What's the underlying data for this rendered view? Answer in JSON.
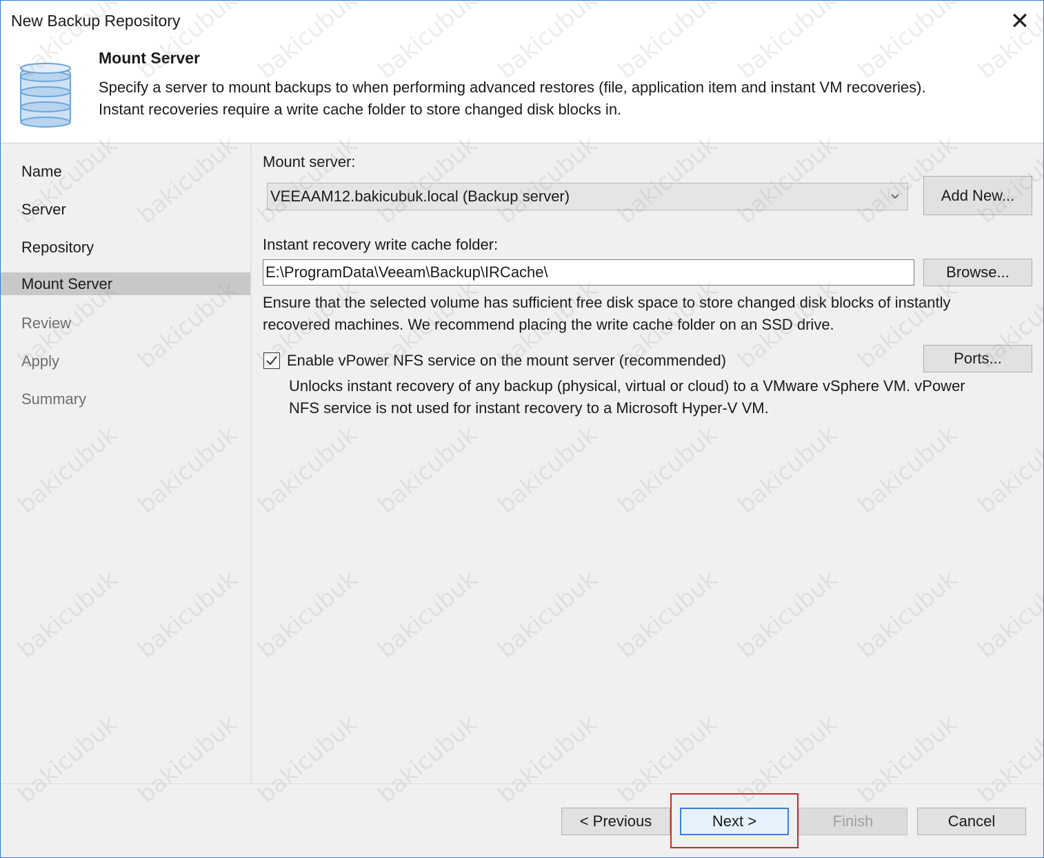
{
  "window": {
    "title": "New Backup Repository",
    "close_glyph": "✕"
  },
  "step": {
    "heading": "Mount Server",
    "description_line1": "Specify a server to mount backups to when performing advanced restores (file, application item and instant VM recoveries).",
    "description_line2": "Instant recoveries require a write cache folder to store changed disk blocks in.",
    "icon": "database-icon"
  },
  "sidebar": {
    "items": [
      {
        "label": "Name",
        "state": "done"
      },
      {
        "label": "Server",
        "state": "done"
      },
      {
        "label": "Repository",
        "state": "done"
      },
      {
        "label": "Mount Server",
        "state": "active"
      },
      {
        "label": "Review",
        "state": "pending"
      },
      {
        "label": "Apply",
        "state": "pending"
      },
      {
        "label": "Summary",
        "state": "pending"
      }
    ]
  },
  "form": {
    "mount_server_label": "Mount server:",
    "mount_server_value": "VEEAAM12.bakicubuk.local (Backup server)",
    "add_new_label": "Add New...",
    "cache_folder_label": "Instant recovery write cache folder:",
    "cache_folder_value": "E:\\ProgramData\\Veeam\\Backup\\IRCache\\",
    "browse_label": "Browse...",
    "ensure_line1": "Ensure that the selected volume has sufficient free disk space to store changed disk blocks of instantly",
    "ensure_line2": "recovered machines. We recommend placing the write cache folder on an SSD drive.",
    "vpower_label": "Enable vPower NFS service on the mount server (recommended)",
    "vpower_checked": true,
    "ports_label": "Ports...",
    "vpower_note_line1": "Unlocks instant recovery of any backup (physical, virtual or cloud) to a VMware vSphere VM.  vPower",
    "vpower_note_line2": "NFS service is not used for instant recovery to a Microsoft Hyper-V VM."
  },
  "footer": {
    "previous_label": "< Previous",
    "next_label": "Next >",
    "finish_label": "Finish",
    "cancel_label": "Cancel"
  },
  "watermark": "bakicubuk",
  "colors": {
    "highlight_box": "#d0262a",
    "active_nav": "#c8c8c8",
    "default_button_border": "#3c7fd1"
  }
}
